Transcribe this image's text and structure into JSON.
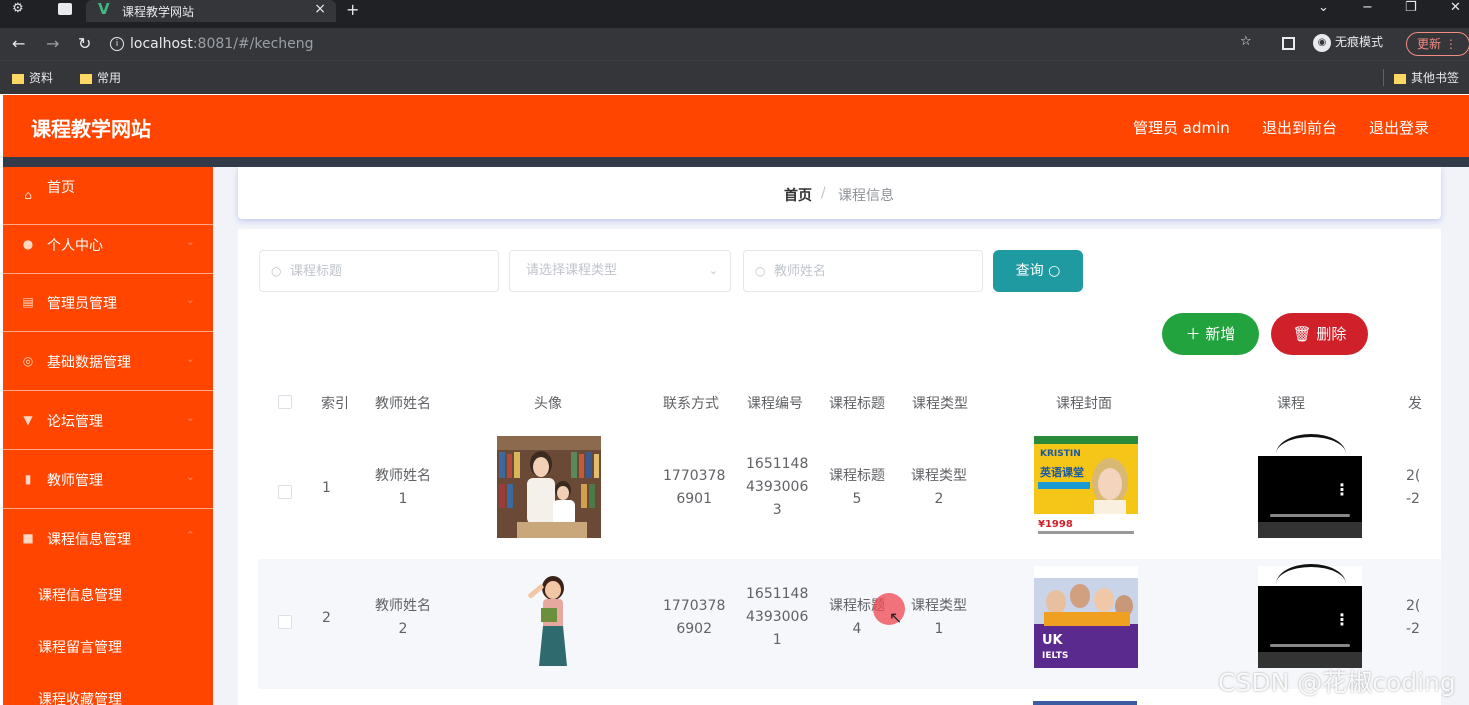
{
  "browser": {
    "tab_title": "课程教学网站",
    "tab_close": "×",
    "new_tab": "+",
    "url_host": "localhost",
    "url_rest": ":8081/#/kecheng",
    "incognito_label": "无痕模式",
    "update_label": "更新",
    "bookmarks": [
      "资料",
      "常用"
    ],
    "other_bookmarks": "其他书签"
  },
  "header": {
    "title": "课程教学网站",
    "admin_label": "管理员 admin",
    "front_label": "退出到前台",
    "logout_label": "退出登录"
  },
  "sidebar": {
    "items": [
      {
        "label": "首页",
        "icon": "home-icon"
      },
      {
        "label": "个人中心",
        "icon": "user-icon"
      },
      {
        "label": "管理员管理",
        "icon": "document-icon"
      },
      {
        "label": "基础数据管理",
        "icon": "compass-icon"
      },
      {
        "label": "论坛管理",
        "icon": "forum-icon"
      },
      {
        "label": "教师管理",
        "icon": "bar-chart-icon"
      },
      {
        "label": "课程信息管理",
        "icon": "folder-icon"
      }
    ],
    "sub_items": [
      "课程信息管理",
      "课程留言管理",
      "课程收藏管理"
    ]
  },
  "breadcrumb": {
    "home": "首页",
    "separator": "/",
    "current": "课程信息"
  },
  "search": {
    "title_placeholder": "课程标题",
    "type_placeholder": "请选择课程类型",
    "teacher_placeholder": "教师姓名",
    "query_label": "查询"
  },
  "actions": {
    "add_label": "新增",
    "delete_label": "删除"
  },
  "table": {
    "headers": [
      "索引",
      "教师姓名",
      "头像",
      "联系方式",
      "课程编号",
      "课程标题",
      "课程类型",
      "课程封面",
      "课程",
      "发"
    ],
    "rows": [
      {
        "index": "1",
        "teacher": [
          "教师姓名",
          "1"
        ],
        "phone": [
          "1770378",
          "6901"
        ],
        "code": [
          "1651148",
          "4393006",
          "3"
        ],
        "title": [
          "课程标题",
          "5"
        ],
        "type": [
          "课程类型",
          "2"
        ],
        "date": [
          "2(",
          "-2"
        ]
      },
      {
        "index": "2",
        "teacher": [
          "教师姓名",
          "2"
        ],
        "phone": [
          "1770378",
          "6902"
        ],
        "code": [
          "1651148",
          "4393006",
          "1"
        ],
        "title": [
          "课程标题",
          "4"
        ],
        "type": [
          "课程类型",
          "1"
        ],
        "date": [
          "2(",
          "-2"
        ]
      }
    ]
  },
  "cover1_text": {
    "brand": "KRISTIN",
    "title": "英语课堂",
    "price": "¥1998"
  },
  "cover2_text": {
    "line1": "UK",
    "line2": "IELTS"
  },
  "watermark": "CSDN @花椒coding",
  "colors": {
    "primary": "#ff4500",
    "query": "#1e9aa0",
    "add": "#22a33e",
    "delete": "#d0202a"
  }
}
